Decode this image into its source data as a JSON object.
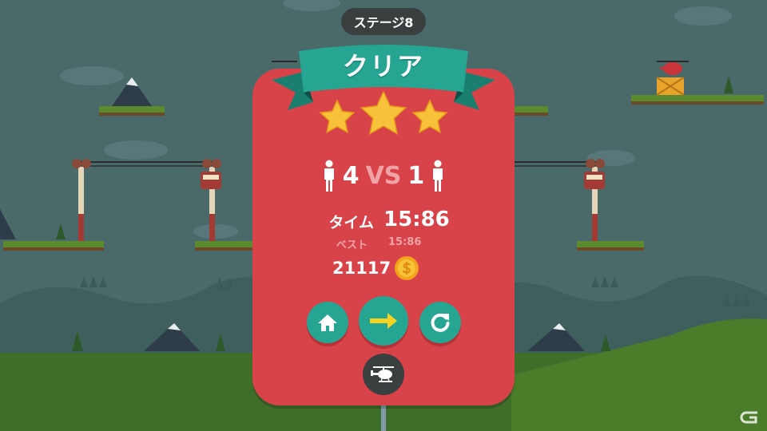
{
  "hud": {
    "stage_label": "ステージ8"
  },
  "result": {
    "title": "クリア",
    "stars_earned": 3,
    "stars_total": 3,
    "players_left": "4",
    "vs_text": "VS",
    "players_right": "1",
    "time_label": "タイム",
    "time_value": "15:86",
    "best_label": "ベスト",
    "best_value": "15:86",
    "coins": "21117"
  },
  "buttons": {
    "home_icon": "home-icon",
    "next_icon": "arrow-right-icon",
    "retry_icon": "retry-icon",
    "helicopter_icon": "helicopter-icon"
  },
  "colors": {
    "card": "#d8434a",
    "ribbon": "#26a592",
    "button": "#26a592",
    "star": "#f7c23a",
    "background": "#4a6a6a",
    "grass": "#4b7c2a"
  }
}
